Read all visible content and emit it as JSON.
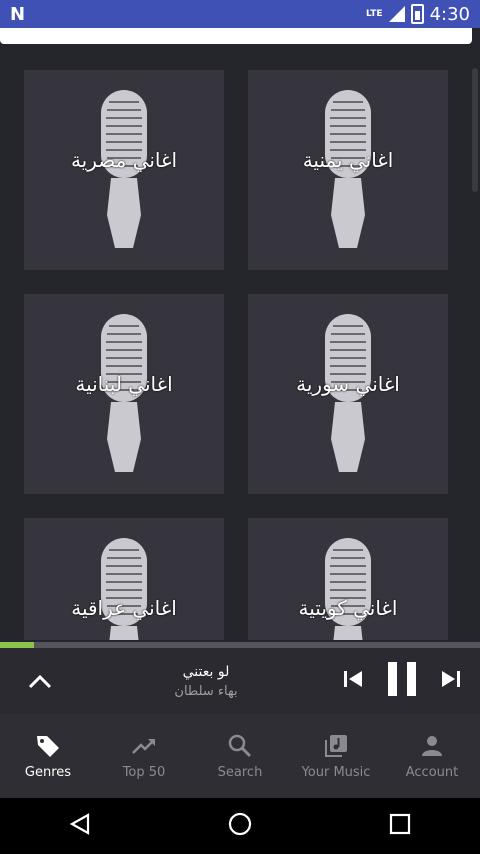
{
  "status_bar": {
    "time": "4:30",
    "network": "LTE",
    "icons": [
      "notification-icon",
      "signal-icon",
      "battery-icon"
    ]
  },
  "genres": [
    {
      "label": "اغاني يمنية"
    },
    {
      "label": "اغاني مصرية"
    },
    {
      "label": "اغاني سورية"
    },
    {
      "label": "اغاني لبنانية"
    },
    {
      "label": "اغاني كويتية"
    },
    {
      "label": "اغاني عراقية"
    }
  ],
  "player": {
    "title": "لو بعتني",
    "artist": "بهاء سلطان",
    "progress": 0.07
  },
  "bottom_nav": [
    {
      "label": "Genres",
      "icon": "tag-icon",
      "active": true
    },
    {
      "label": "Top 50",
      "icon": "trending-icon",
      "active": false
    },
    {
      "label": "Search",
      "icon": "search-icon",
      "active": false
    },
    {
      "label": "Your Music",
      "icon": "library-music-icon",
      "active": false
    },
    {
      "label": "Account",
      "icon": "account-icon",
      "active": false
    }
  ],
  "colors": {
    "status_bar": "#3f51b5",
    "background": "#25252c",
    "tile": "#36353d",
    "progress": "#8bc34a"
  }
}
